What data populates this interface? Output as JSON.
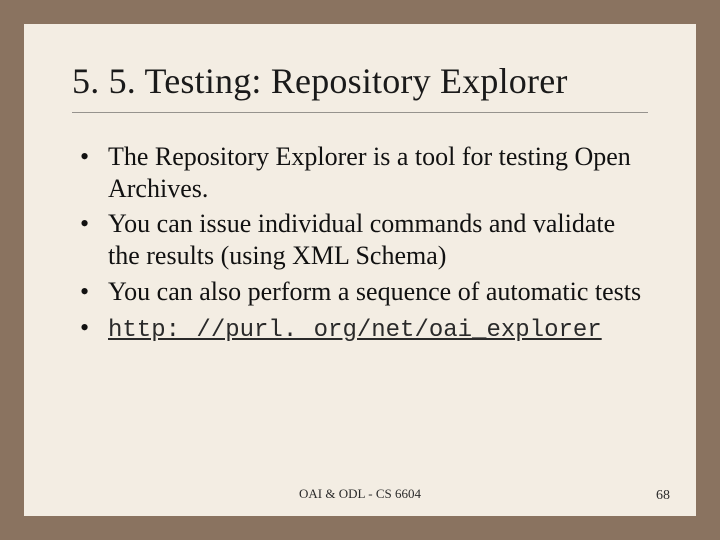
{
  "title": "5. 5. Testing: Repository Explorer",
  "bullets": [
    "The Repository Explorer is a tool for testing Open Archives.",
    "You can issue individual commands and validate the results (using XML Schema)",
    "You can also perform a sequence of automatic tests"
  ],
  "link_text": "http: //purl. org/net/oai_explorer",
  "footer": "OAI & ODL - CS 6604",
  "page_number": "68"
}
